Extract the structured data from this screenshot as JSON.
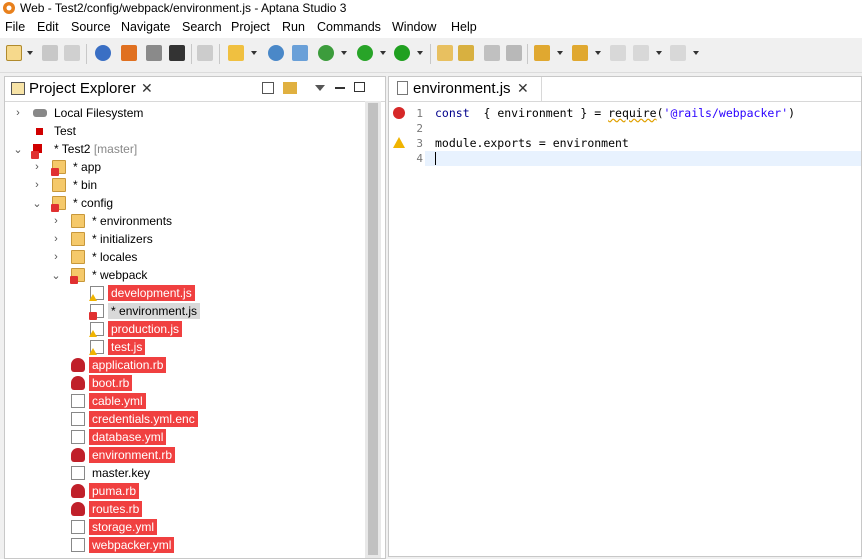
{
  "window": {
    "title": "Web - Test2/config/webpack/environment.js - Aptana Studio 3"
  },
  "menu": [
    "File",
    "Edit",
    "Source",
    "Navigate",
    "Search",
    "Project",
    "Run",
    "Commands",
    "Window",
    "Help"
  ],
  "project_explorer": {
    "title": "Project Explorer",
    "close_glyph": "✕",
    "tree": [
      {
        "label": "Local Filesystem",
        "prefix": "",
        "suffix": "",
        "depth": 0,
        "expander": "›",
        "icon": "drive-icon",
        "style": "normal"
      },
      {
        "label": "Test",
        "prefix": "",
        "suffix": "",
        "depth": 0,
        "expander": "",
        "icon": "project-icon",
        "style": "normal"
      },
      {
        "label": "Test2",
        "prefix": "* ",
        "suffix": " [master]",
        "depth": 0,
        "expander": "⌄",
        "icon": "project-error-icon",
        "style": "normal"
      },
      {
        "label": "app",
        "prefix": "* ",
        "suffix": "",
        "depth": 1,
        "expander": "›",
        "icon": "folder-error-icon",
        "style": "normal"
      },
      {
        "label": "bin",
        "prefix": "* ",
        "suffix": "",
        "depth": 1,
        "expander": "›",
        "icon": "folder-icon",
        "style": "normal"
      },
      {
        "label": "config",
        "prefix": "* ",
        "suffix": "",
        "depth": 1,
        "expander": "⌄",
        "icon": "folder-error-icon",
        "style": "normal"
      },
      {
        "label": "environments",
        "prefix": "* ",
        "suffix": "",
        "depth": 2,
        "expander": "›",
        "icon": "folder-icon",
        "style": "normal"
      },
      {
        "label": "initializers",
        "prefix": "* ",
        "suffix": "",
        "depth": 2,
        "expander": "›",
        "icon": "folder-icon",
        "style": "normal"
      },
      {
        "label": "locales",
        "prefix": "* ",
        "suffix": "",
        "depth": 2,
        "expander": "›",
        "icon": "folder-icon",
        "style": "normal"
      },
      {
        "label": "webpack",
        "prefix": "* ",
        "suffix": "",
        "depth": 2,
        "expander": "⌄",
        "icon": "folder-error-icon",
        "style": "normal"
      },
      {
        "label": "development.js",
        "prefix": "",
        "suffix": "",
        "depth": 3,
        "expander": "",
        "icon": "js-warning-icon",
        "style": "red"
      },
      {
        "label": "environment.js",
        "prefix": "* ",
        "suffix": "",
        "depth": 3,
        "expander": "",
        "icon": "js-error-icon",
        "style": "selected"
      },
      {
        "label": "production.js",
        "prefix": "",
        "suffix": "",
        "depth": 3,
        "expander": "",
        "icon": "js-warning-icon",
        "style": "red"
      },
      {
        "label": "test.js",
        "prefix": "",
        "suffix": "",
        "depth": 3,
        "expander": "",
        "icon": "js-warning-icon",
        "style": "red"
      },
      {
        "label": "application.rb",
        "prefix": "",
        "suffix": "",
        "depth": 2,
        "expander": "",
        "icon": "ruby-icon",
        "style": "red"
      },
      {
        "label": "boot.rb",
        "prefix": "",
        "suffix": "",
        "depth": 2,
        "expander": "",
        "icon": "ruby-icon",
        "style": "red"
      },
      {
        "label": "cable.yml",
        "prefix": "",
        "suffix": "",
        "depth": 2,
        "expander": "",
        "icon": "yaml-icon",
        "style": "red"
      },
      {
        "label": "credentials.yml.enc",
        "prefix": "",
        "suffix": "",
        "depth": 2,
        "expander": "",
        "icon": "file-icon",
        "style": "red"
      },
      {
        "label": "database.yml",
        "prefix": "",
        "suffix": "",
        "depth": 2,
        "expander": "",
        "icon": "yaml-icon",
        "style": "red"
      },
      {
        "label": "environment.rb",
        "prefix": "",
        "suffix": "",
        "depth": 2,
        "expander": "",
        "icon": "ruby-icon",
        "style": "red"
      },
      {
        "label": "master.key",
        "prefix": "",
        "suffix": "",
        "depth": 2,
        "expander": "",
        "icon": "text-file-icon",
        "style": "normal"
      },
      {
        "label": "puma.rb",
        "prefix": "",
        "suffix": "",
        "depth": 2,
        "expander": "",
        "icon": "ruby-icon",
        "style": "red"
      },
      {
        "label": "routes.rb",
        "prefix": "",
        "suffix": "",
        "depth": 2,
        "expander": "",
        "icon": "ruby-icon",
        "style": "red"
      },
      {
        "label": "storage.yml",
        "prefix": "",
        "suffix": "",
        "depth": 2,
        "expander": "",
        "icon": "yaml-icon",
        "style": "red"
      },
      {
        "label": "webpacker.yml",
        "prefix": "",
        "suffix": "",
        "depth": 2,
        "expander": "",
        "icon": "yaml-icon",
        "style": "red"
      }
    ]
  },
  "editor": {
    "tab_label": "environment.js",
    "close_glyph": "✕",
    "lines": [
      {
        "num": "1",
        "marker": "error",
        "tokens": [
          [
            "kw",
            "const"
          ],
          [
            "",
            "  { environment } = "
          ],
          [
            "squig",
            "require"
          ],
          [
            "",
            "("
          ],
          [
            "str",
            "'@rails/webpacker'"
          ],
          [
            "",
            ")"
          ]
        ]
      },
      {
        "num": "2",
        "marker": "",
        "tokens": []
      },
      {
        "num": "3",
        "marker": "warning",
        "tokens": [
          [
            "",
            "module.exports = environment"
          ]
        ]
      },
      {
        "num": "4",
        "marker": "",
        "tokens": []
      }
    ]
  },
  "colors": {
    "problem_highlight": "#f04040",
    "selection": "#d9d9d9",
    "current_line": "#e8f2fe"
  }
}
